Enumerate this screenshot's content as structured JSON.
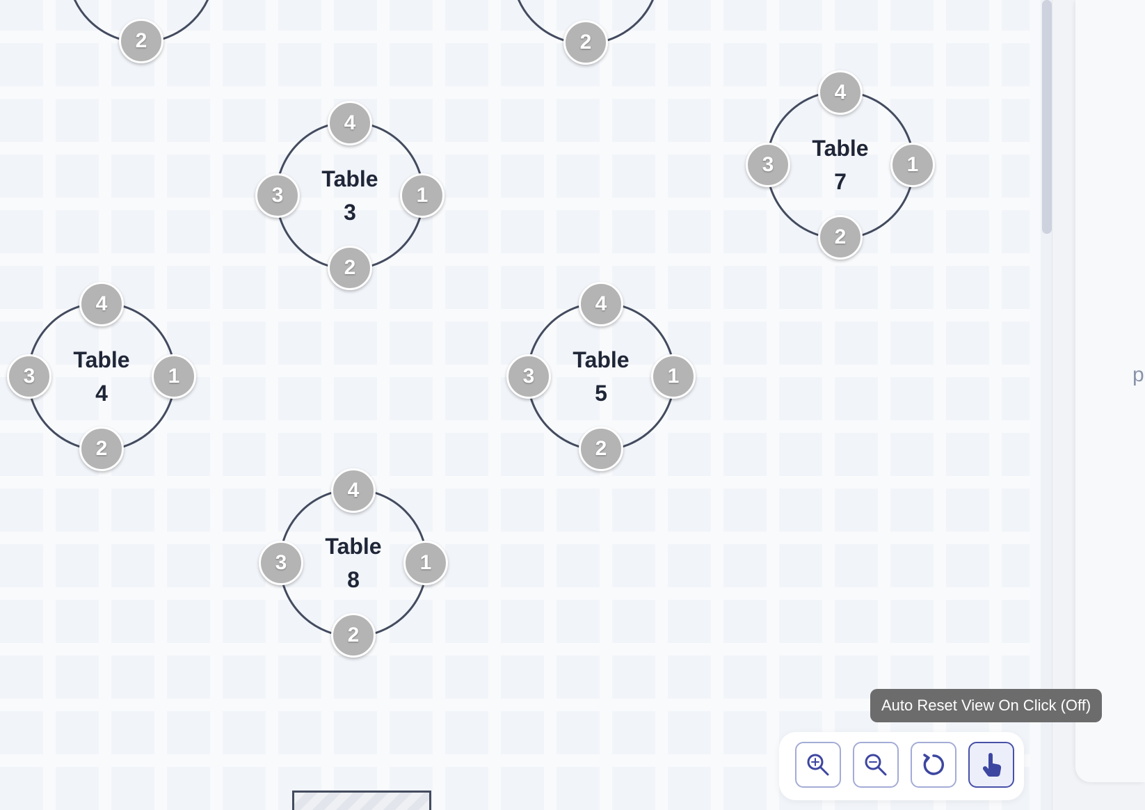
{
  "tables": [
    {
      "id": "top-left",
      "label_line1": "",
      "label_line2": "",
      "seats": [
        "",
        "2",
        "",
        ""
      ]
    },
    {
      "id": "top-mid",
      "label_line1": "",
      "label_line2": "",
      "seats": [
        "",
        "2",
        "",
        ""
      ]
    },
    {
      "id": "table-3",
      "label_line1": "Table",
      "label_line2": "3",
      "seats": [
        "1",
        "2",
        "3",
        "4"
      ]
    },
    {
      "id": "table-7",
      "label_line1": "Table",
      "label_line2": "7",
      "seats": [
        "1",
        "2",
        "3",
        "4"
      ]
    },
    {
      "id": "table-4",
      "label_line1": "Table",
      "label_line2": "4",
      "seats": [
        "1",
        "2",
        "3",
        "4"
      ]
    },
    {
      "id": "table-5",
      "label_line1": "Table",
      "label_line2": "5",
      "seats": [
        "1",
        "2",
        "3",
        "4"
      ]
    },
    {
      "id": "table-8",
      "label_line1": "Table",
      "label_line2": "8",
      "seats": [
        "1",
        "2",
        "3",
        "4"
      ]
    }
  ],
  "tooltip": {
    "text": "Auto Reset View On Click (Off)"
  },
  "toolbar": {
    "buttons": [
      {
        "icon": "zoom-in-icon"
      },
      {
        "icon": "zoom-out-icon"
      },
      {
        "icon": "reset-view-icon"
      },
      {
        "icon": "touch-hand-icon",
        "active": true
      }
    ]
  },
  "side_panel": {
    "partial_text": "p"
  },
  "colors": {
    "accent": "#4750a8",
    "seat": "#b4b4b4",
    "table_border": "#434b5e",
    "tooltip_bg": "#6c6c6c"
  }
}
